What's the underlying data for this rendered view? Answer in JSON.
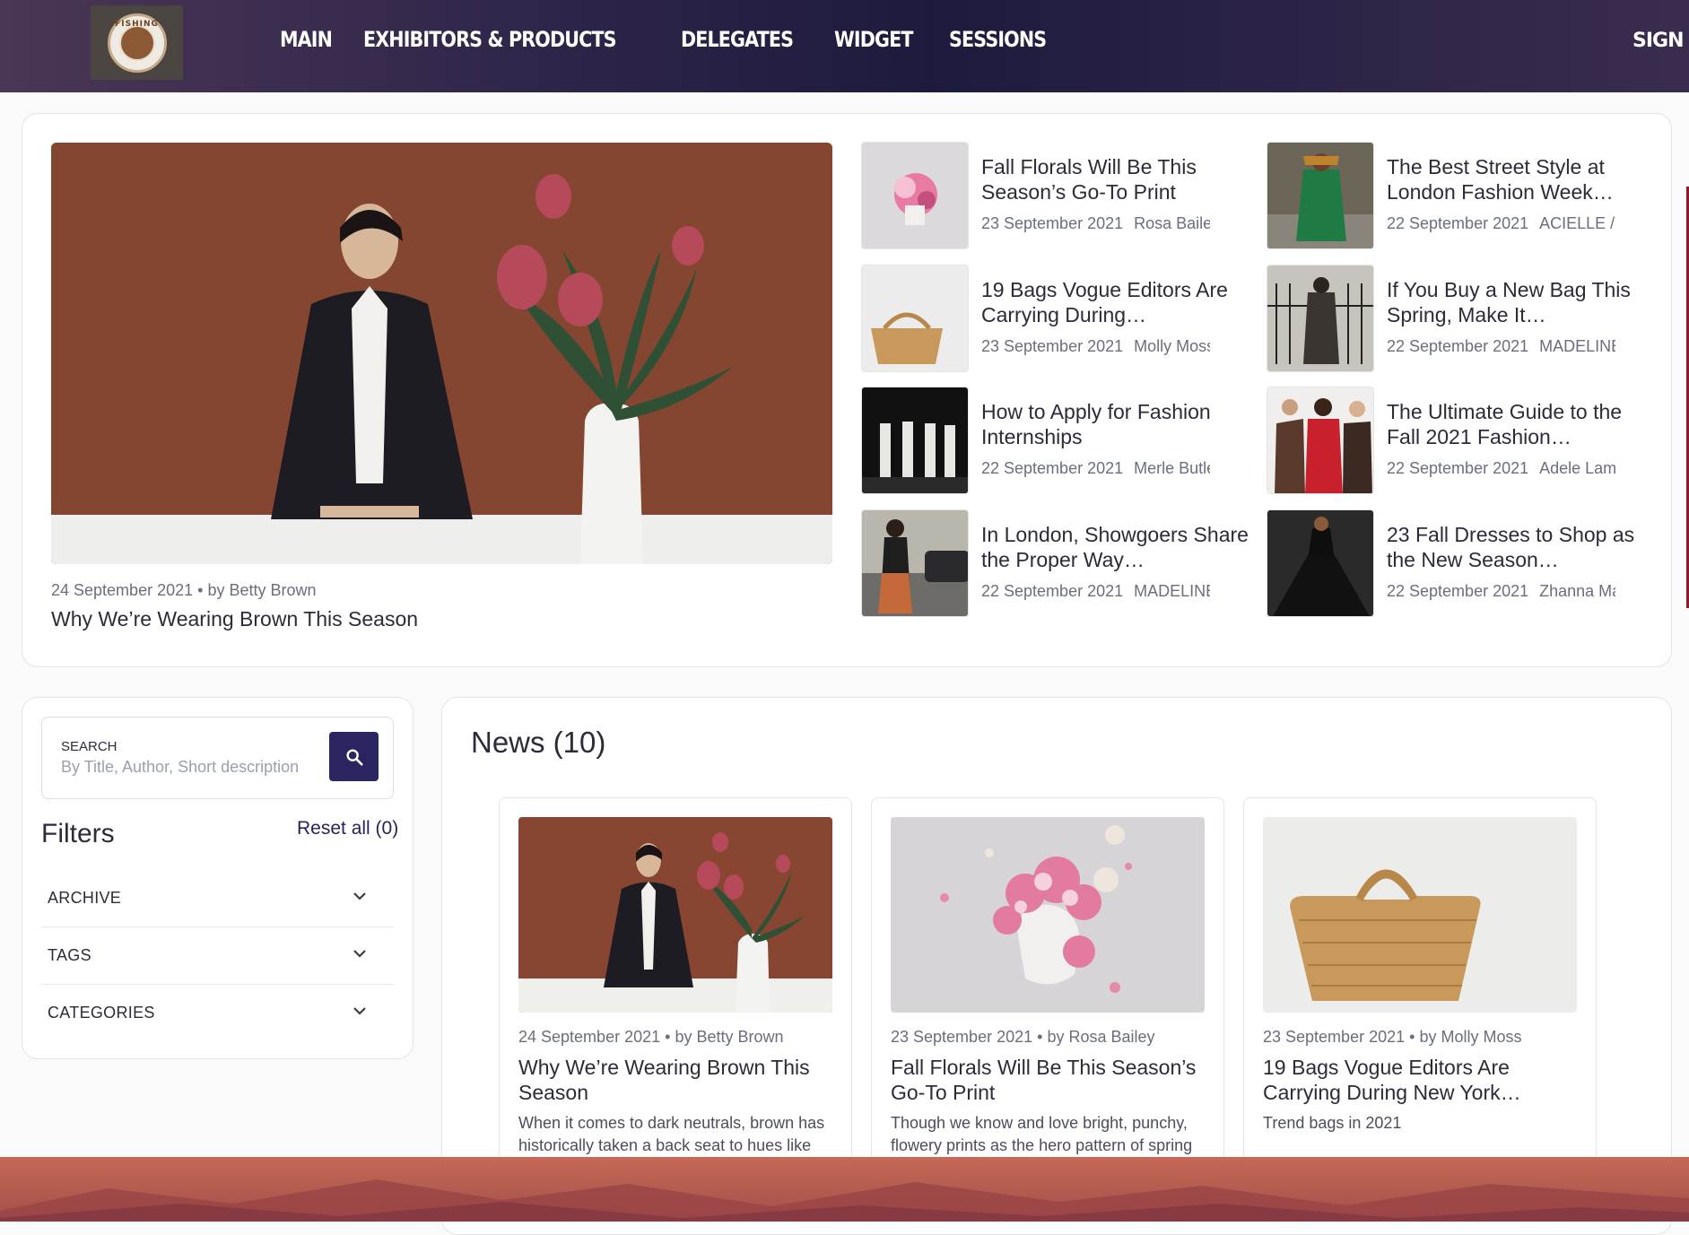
{
  "header": {
    "logo_text": "FISHING",
    "nav": [
      "MAIN",
      "EXHIBITORS & PRODUCTS",
      "DELEGATES",
      "WIDGET",
      "SESSIONS"
    ],
    "sign_in": "SIGN IN"
  },
  "featured": {
    "date": "24 September 2021",
    "author": "by Betty Brown",
    "title": "Why We’re Wearing Brown This Season",
    "side_items": [
      {
        "title": "Fall Florals Will Be This Season’s Go-To Print",
        "date": "23 September 2021",
        "author": "Rosa Bailey"
      },
      {
        "title": "The Best Street Style at London Fashion Week…",
        "date": "22 September 2021",
        "author": "ACIELLE / STYLE DU MONDE"
      },
      {
        "title": "19 Bags Vogue Editors Are Carrying During…",
        "date": "23 September 2021",
        "author": "Molly Moss"
      },
      {
        "title": "If You Buy a New Bag This Spring, Make It…",
        "date": "22 September 2021",
        "author": "MADELINE FASS"
      },
      {
        "title": "How to Apply for Fashion Internships",
        "date": "22 September 2021",
        "author": "Merle Butler"
      },
      {
        "title": "The Ultimate Guide to the Fall 2021 Fashion…",
        "date": "22 September 2021",
        "author": "Adele Lamb"
      },
      {
        "title": "In London, Showgoers Share the Proper Way…",
        "date": "22 September 2021",
        "author": "MADELINE FASS"
      },
      {
        "title": "23 Fall Dresses to Shop as the New Season…",
        "date": "22 September 2021",
        "author": "Zhanna Mashkova"
      }
    ]
  },
  "filters": {
    "search_label": "SEARCH",
    "search_placeholder": "By Title, Author, Short description",
    "title": "Filters",
    "reset": "Reset all (0)",
    "sections": [
      "ARCHIVE",
      "TAGS",
      "CATEGORIES"
    ]
  },
  "news": {
    "title": "News (10)",
    "cards": [
      {
        "date": "24 September 2021",
        "author": "by Betty Brown",
        "title": "Why We’re Wearing Brown This Season",
        "desc": "When it comes to dark neutrals, brown has historically taken a back seat to hues like"
      },
      {
        "date": "23 September 2021",
        "author": "by Rosa Bailey",
        "title": "Fall Florals Will Be This Season’s Go-To Print",
        "desc": "Though we know and love bright, punchy, flowery prints as the hero pattern of spring"
      },
      {
        "date": "23 September 2021",
        "author": "by Molly Moss",
        "title": "19 Bags Vogue Editors Are Carrying During New York…",
        "desc": "Trend bags in 2021"
      }
    ]
  },
  "colors": {
    "header_dark": "#1d1b3d",
    "accent": "#2a2560",
    "text": "#2b2b3a",
    "meta": "#6a6e7e"
  }
}
